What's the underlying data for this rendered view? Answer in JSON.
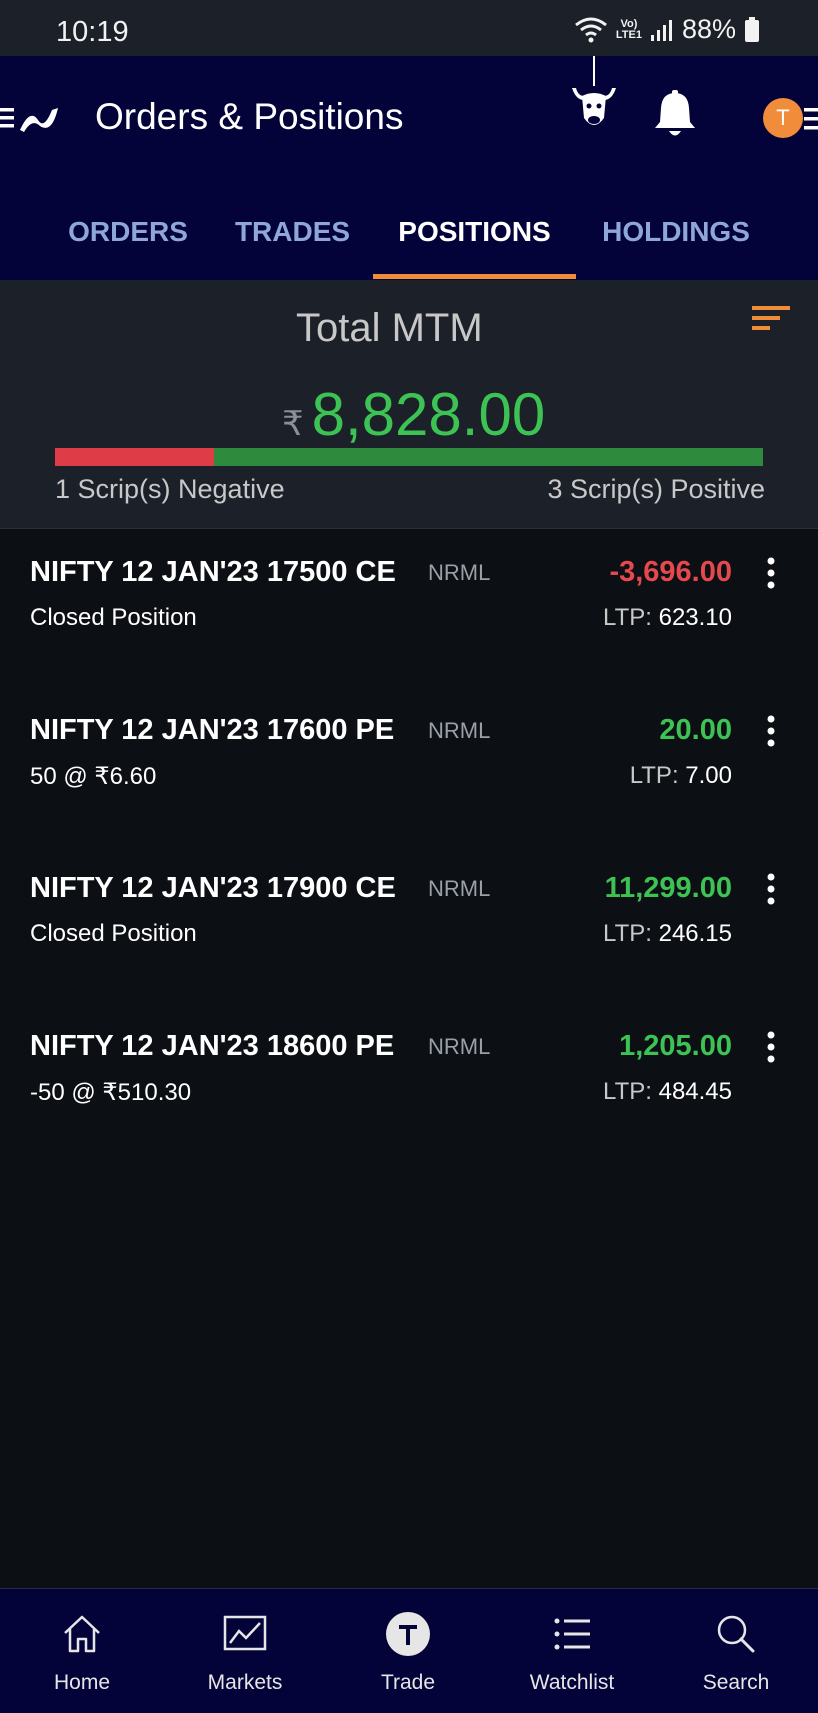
{
  "status_bar": {
    "time": "10:19",
    "network": "LTE1",
    "battery": "88%"
  },
  "header": {
    "title": "Orders & Positions",
    "avatar_initial": "T"
  },
  "tabs": [
    {
      "label": "ORDERS",
      "active": false
    },
    {
      "label": "TRADES",
      "active": false
    },
    {
      "label": "POSITIONS",
      "active": true
    },
    {
      "label": "HOLDINGS",
      "active": false
    }
  ],
  "mtm": {
    "label": "Total MTM",
    "currency": "₹",
    "value": "8,828.00",
    "negative_text": "1 Scrip(s) Negative",
    "positive_text": "3 Scrip(s) Positive",
    "negative_count": 1,
    "positive_count": 3
  },
  "positions": [
    {
      "name": "NIFTY 12 JAN'23 17500 CE",
      "product": "NRML",
      "sub": "Closed Position",
      "pnl": "-3,696.00",
      "pnl_sign": "negative",
      "ltp_label": "LTP:",
      "ltp": "623.10"
    },
    {
      "name": "NIFTY 12 JAN'23 17600 PE",
      "product": "NRML",
      "sub": "50 @ ₹6.60",
      "pnl": "20.00",
      "pnl_sign": "positive",
      "ltp_label": "LTP:",
      "ltp": "7.00"
    },
    {
      "name": "NIFTY 12 JAN'23 17900 CE",
      "product": "NRML",
      "sub": "Closed Position",
      "pnl": "11,299.00",
      "pnl_sign": "positive",
      "ltp_label": "LTP:",
      "ltp": "246.15"
    },
    {
      "name": "NIFTY 12 JAN'23 18600 PE",
      "product": "NRML",
      "sub": "-50 @ ₹510.30",
      "pnl": "1,205.00",
      "pnl_sign": "positive",
      "ltp_label": "LTP:",
      "ltp": "484.45"
    }
  ],
  "bottom_nav": [
    {
      "label": "Home",
      "icon": "home-icon"
    },
    {
      "label": "Markets",
      "icon": "markets-chart-icon"
    },
    {
      "label": "Trade",
      "icon": "trade-t-icon"
    },
    {
      "label": "Watchlist",
      "icon": "watchlist-icon"
    },
    {
      "label": "Search",
      "icon": "search-icon"
    }
  ],
  "colors": {
    "header_bg": "#03033a",
    "panel_bg": "#1b2029",
    "list_bg": "#0c0f14",
    "accent_orange": "#f08c3a",
    "positive_green": "#3dc354",
    "negative_red": "#e5484d",
    "tab_inactive": "#8fa6d8"
  }
}
